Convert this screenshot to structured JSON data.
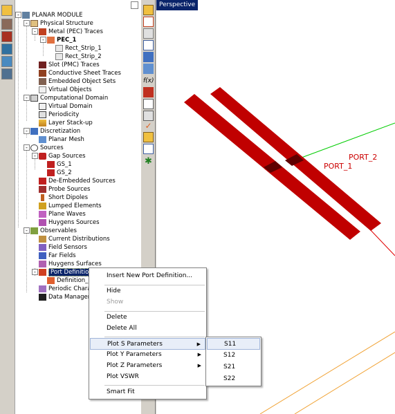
{
  "viewport": {
    "view_label": "Perspective",
    "ports": [
      "PORT_2",
      "PORT_1"
    ]
  },
  "tree": {
    "root": "PLANAR MODULE",
    "items": [
      "Physical Structure",
      "Metal (PEC) Traces",
      "PEC_1",
      "Rect_Strip_1",
      "Rect_Strip_2",
      "Slot (PMC) Traces",
      "Conductive Sheet Traces",
      "Embedded Object Sets",
      "Virtual Objects",
      "Computational Domain",
      "Virtual Domain",
      "Periodicity",
      "Layer Stack-up",
      "Discretization",
      "Planar Mesh",
      "Sources",
      "Gap Sources",
      "GS_1",
      "GS_2",
      "De-Embedded Sources",
      "Probe Sources",
      "Short Dipoles",
      "Lumped Elements",
      "Plane Waves",
      "Huygens Sources",
      "Observables",
      "Current Distributions",
      "Field Sensors",
      "Far Fields",
      "Huygens Surfaces",
      "Port Definitions",
      "Definition_",
      "Periodic Chara",
      "Data Manager"
    ]
  },
  "context_menu": {
    "items": [
      {
        "label": "Insert New Port Definition...",
        "enabled": true
      },
      {
        "label": "Hide",
        "enabled": true
      },
      {
        "label": "Show",
        "enabled": false
      },
      {
        "label": "Delete",
        "enabled": true
      },
      {
        "label": "Delete All",
        "enabled": true
      },
      {
        "label": "Plot S Parameters",
        "enabled": true,
        "submenu": true,
        "highlighted": true
      },
      {
        "label": "Plot Y Parameters",
        "enabled": true,
        "submenu": true
      },
      {
        "label": "Plot Z Parameters",
        "enabled": true,
        "submenu": true
      },
      {
        "label": "Plot VSWR",
        "enabled": true
      },
      {
        "label": "Smart Fit",
        "enabled": true
      }
    ]
  },
  "submenu": {
    "items": [
      "S11",
      "S12",
      "S21",
      "S22"
    ],
    "highlighted": "S11"
  },
  "colors": {
    "trace_red": "#c00000",
    "selection_blue": "#0a246a",
    "axis_green": "#00cc00",
    "axis_red": "#e00000",
    "boundary_orange": "#f0a030"
  },
  "icons": {
    "left_toolbar": [
      "module-icon",
      "layers-icon",
      "radiation-icon",
      "mesh-icon",
      "network-icon",
      "schematic-icon"
    ],
    "mid_toolbar": [
      "ruler-icon",
      "scissors-icon",
      "copy-icon",
      "shape-icon",
      "grid-icon",
      "grid-alt-icon",
      "function-icon",
      "excel-icon",
      "graph-icon",
      "chart-icon",
      "check-icon",
      "edit-icon",
      "doc-icon",
      "gear-icon"
    ]
  }
}
